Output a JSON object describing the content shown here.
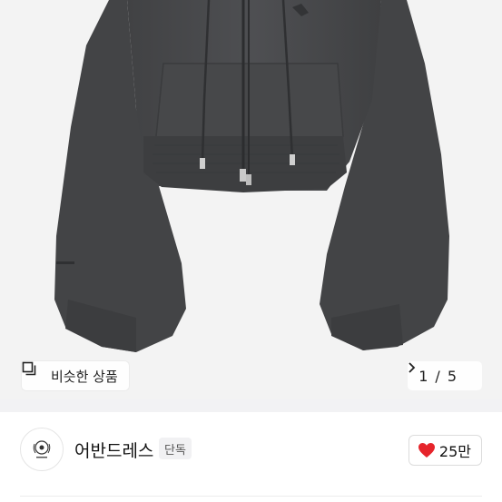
{
  "gallery": {
    "similar_label": "비슷한 상품",
    "page_current": "1",
    "page_separator": "/",
    "page_total": "5"
  },
  "seller": {
    "name": "어반드레스",
    "badge": "단독",
    "likes": "25만"
  },
  "icons": {
    "similar": "similar-products-icon",
    "next": "chevron-right-icon",
    "like": "heart-icon",
    "avatar": "seller-logo"
  },
  "colors": {
    "heart": "#e6242b",
    "hoodie": "#4a4b4d",
    "hero_background": "#f3f3f3"
  }
}
